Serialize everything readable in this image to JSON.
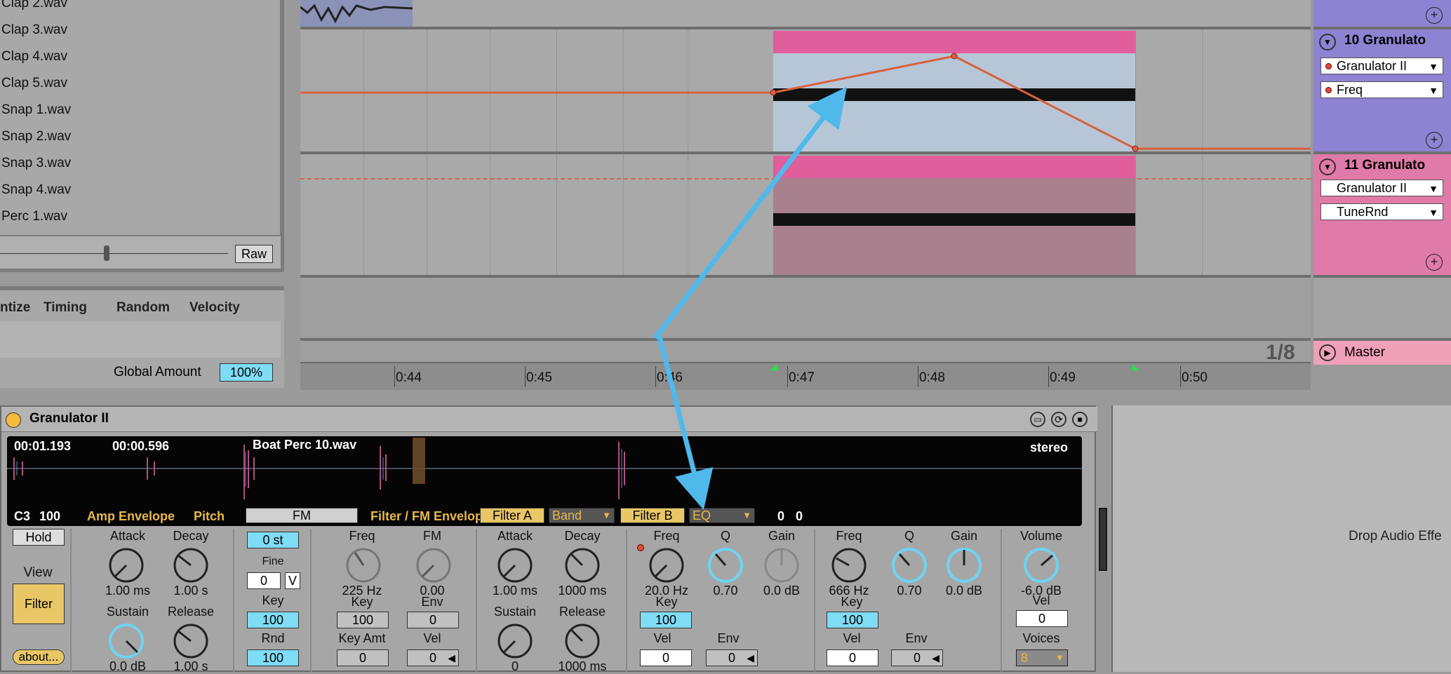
{
  "browser": {
    "files": [
      "Clap 2.wav",
      "Clap 3.wav",
      "Clap 4.wav",
      "Clap 5.wav",
      "Snap 1.wav",
      "Snap 2.wav",
      "Snap 3.wav",
      "Snap 4.wav",
      "Perc 1.wav"
    ],
    "raw_label": "Raw"
  },
  "groove": {
    "tabs": [
      "ntize",
      "Timing",
      "Random",
      "Velocity"
    ],
    "global_amount_label": "Global Amount",
    "global_amount_value": "100%"
  },
  "arrangement": {
    "zoom_label": "1/8",
    "ruler_ticks": [
      "0:44",
      "0:45",
      "0:46",
      "0:47",
      "0:48",
      "0:49",
      "0:50"
    ]
  },
  "tracks": [
    {
      "name": "10 Granulato",
      "device_select": "Granulator II",
      "param_select": "Freq",
      "color": "#8e82d2"
    },
    {
      "name": "11 Granulato",
      "device_select": "Granulator II",
      "param_select": "TuneRnd",
      "color": "#e07aa8"
    }
  ],
  "master": {
    "name": "Master"
  },
  "device": {
    "title": "Granulator II",
    "time_start": "00:01.193",
    "time_len": "00:00.596",
    "filename": "Boat Perc 10.wav",
    "stereo": "stereo",
    "note": "C3",
    "velocity": "100",
    "hdr_amp": "Amp Envelope",
    "hdr_pitch": "Pitch",
    "hdr_fm": "FM",
    "hdr_filter_env": "Filter / FM Envelope",
    "filter_a": "Filter A",
    "filter_a_type": "Band",
    "filter_b": "Filter B",
    "filter_b_type": "EQ",
    "out_l": "0",
    "out_r": "0",
    "hold": "Hold",
    "view": "View",
    "filter_view": "Filter",
    "about": "about...",
    "amp": {
      "attack_label": "Attack",
      "attack": "1.00 ms",
      "decay_label": "Decay",
      "decay": "1.00 s",
      "sustain_label": "Sustain",
      "sustain": "0.0 dB",
      "release_label": "Release",
      "release": "1.00 s"
    },
    "pitch": {
      "st": "0 st",
      "fine_label": "Fine",
      "fine": "0",
      "v": "V",
      "key_label": "Key",
      "key": "100",
      "rnd_label": "Rnd",
      "rnd": "100"
    },
    "fm": {
      "freq_label": "Freq",
      "freq": "225 Hz",
      "fm_label": "FM",
      "fm": "0.00",
      "key_label": "Key",
      "key": "100",
      "env_label": "Env",
      "env": "0",
      "keyamt_label": "Key Amt",
      "keyamt": "0",
      "vel_label": "Vel",
      "vel": "0"
    },
    "fenv": {
      "attack_label": "Attack",
      "attack": "1.00 ms",
      "decay_label": "Decay",
      "decay": "1000 ms",
      "sustain_label": "Sustain",
      "sustain": "0",
      "release_label": "Release",
      "release": "1000 ms"
    },
    "fa": {
      "freq_label": "Freq",
      "freq": "20.0 Hz",
      "q_label": "Q",
      "q": "0.70",
      "gain_label": "Gain",
      "gain": "0.0 dB",
      "key_label": "Key",
      "key": "100",
      "vel_label": "Vel",
      "vel": "0",
      "env_label": "Env",
      "env": "0"
    },
    "fb": {
      "freq_label": "Freq",
      "freq": "666 Hz",
      "q_label": "Q",
      "q": "0.70",
      "gain_label": "Gain",
      "gain": "0.0 dB",
      "key_label": "Key",
      "key": "100",
      "vel_label": "Vel",
      "vel": "0",
      "env_label": "Env",
      "env": "0"
    },
    "out": {
      "volume_label": "Volume",
      "volume": "-6.0 dB",
      "vel_label": "Vel",
      "vel": "0",
      "voices_label": "Voices",
      "voices": "8"
    }
  },
  "drop_label": "Drop Audio Effe"
}
